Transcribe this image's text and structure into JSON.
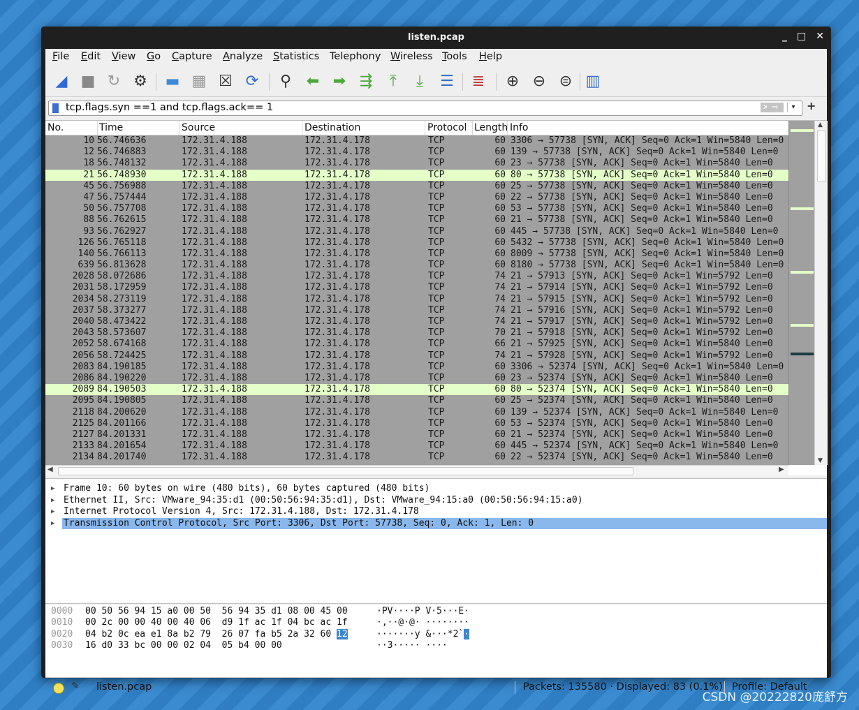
{
  "window": {
    "title": "listen.pcap",
    "controls": [
      "_",
      "□",
      "✕"
    ]
  },
  "menu": [
    {
      "label": "File",
      "key": "F",
      "rest": "ile"
    },
    {
      "label": "Edit",
      "key": "E",
      "rest": "dit"
    },
    {
      "label": "View",
      "key": "V",
      "rest": "iew"
    },
    {
      "label": "Go",
      "key": "G",
      "rest": "o"
    },
    {
      "label": "Capture",
      "key": "C",
      "rest": "apture"
    },
    {
      "label": "Analyze",
      "key": "A",
      "rest": "nalyze"
    },
    {
      "label": "Statistics",
      "key": "S",
      "rest": "tatistics"
    },
    {
      "label": "Telephony",
      "key": "",
      "rest": "Telephony"
    },
    {
      "label": "Wireless",
      "key": "W",
      "rest": "ireless"
    },
    {
      "label": "Tools",
      "key": "T",
      "rest": "ools"
    },
    {
      "label": "Help",
      "key": "H",
      "rest": "elp"
    }
  ],
  "toolbar": [
    {
      "name": "start-capture-icon",
      "glyph": "◢",
      "color": "#2d6ad3"
    },
    {
      "name": "stop-capture-icon",
      "glyph": "■",
      "color": "#8a8a8a"
    },
    {
      "name": "restart-capture-icon",
      "glyph": "↻",
      "color": "#9a9a9a"
    },
    {
      "name": "capture-options-icon",
      "glyph": "⚙",
      "color": "#333333"
    },
    {
      "name": "open-file-icon",
      "glyph": "▬",
      "color": "#3a8ad8"
    },
    {
      "name": "save-file-icon",
      "glyph": "▦",
      "color": "#9a9a9a"
    },
    {
      "name": "close-file-icon",
      "glyph": "☒",
      "color": "#333333"
    },
    {
      "name": "reload-file-icon",
      "glyph": "⟳",
      "color": "#2d6ad3"
    },
    {
      "name": "find-packet-icon",
      "glyph": "⚲",
      "color": "#333333"
    },
    {
      "name": "go-back-icon",
      "glyph": "⬅",
      "color": "#4aa83a"
    },
    {
      "name": "go-forward-icon",
      "glyph": "➡",
      "color": "#4aa83a"
    },
    {
      "name": "go-to-packet-icon",
      "glyph": "⇶",
      "color": "#4aa83a"
    },
    {
      "name": "go-first-packet-icon",
      "glyph": "⤒",
      "color": "#4aa83a"
    },
    {
      "name": "go-last-packet-icon",
      "glyph": "⤓",
      "color": "#4aa83a"
    },
    {
      "name": "auto-scroll-icon",
      "glyph": "☰",
      "color": "#3a6fc0"
    },
    {
      "name": "colorize-icon",
      "glyph": "≣",
      "color": "#c03a3a"
    },
    {
      "name": "zoom-in-icon",
      "glyph": "⊕",
      "color": "#333333"
    },
    {
      "name": "zoom-out-icon",
      "glyph": "⊖",
      "color": "#333333"
    },
    {
      "name": "normal-size-icon",
      "glyph": "⊜",
      "color": "#333333"
    },
    {
      "name": "resize-columns-icon",
      "glyph": "▥",
      "color": "#3a6fc0"
    }
  ],
  "filter": {
    "value": "tcp.flags.syn ==1 and tcp.flags.ack== 1",
    "clear_glyph": "✕",
    "apply_glyph": "⇨",
    "dropdown_glyph": "▾",
    "add_glyph": "+"
  },
  "columns": [
    "No.",
    "Time",
    "Source",
    "Destination",
    "Protocol",
    "Length",
    "Info"
  ],
  "packets": [
    {
      "no": "10",
      "time": "56.746636",
      "src": "172.31.4.188",
      "dst": "172.31.4.178",
      "proto": "TCP",
      "len": "60",
      "info": "3306 → 57738 [SYN, ACK] Seq=0 Ack=1 Win=5840 Len=0",
      "sel": false
    },
    {
      "no": "12",
      "time": "56.746883",
      "src": "172.31.4.188",
      "dst": "172.31.4.178",
      "proto": "TCP",
      "len": "60",
      "info": "139 → 57738 [SYN, ACK] Seq=0 Ack=1 Win=5840 Len=0",
      "sel": false
    },
    {
      "no": "18",
      "time": "56.748132",
      "src": "172.31.4.188",
      "dst": "172.31.4.178",
      "proto": "TCP",
      "len": "60",
      "info": "23 → 57738 [SYN, ACK] Seq=0 Ack=1 Win=5840 Len=0",
      "sel": false
    },
    {
      "no": "21",
      "time": "56.748930",
      "src": "172.31.4.188",
      "dst": "172.31.4.178",
      "proto": "TCP",
      "len": "60",
      "info": "80 → 57738 [SYN, ACK] Seq=0 Ack=1 Win=5840 Len=0",
      "sel": true
    },
    {
      "no": "45",
      "time": "56.756988",
      "src": "172.31.4.188",
      "dst": "172.31.4.178",
      "proto": "TCP",
      "len": "60",
      "info": "25 → 57738 [SYN, ACK] Seq=0 Ack=1 Win=5840 Len=0",
      "sel": false
    },
    {
      "no": "47",
      "time": "56.757444",
      "src": "172.31.4.188",
      "dst": "172.31.4.178",
      "proto": "TCP",
      "len": "60",
      "info": "22 → 57738 [SYN, ACK] Seq=0 Ack=1 Win=5840 Len=0",
      "sel": false
    },
    {
      "no": "50",
      "time": "56.757708",
      "src": "172.31.4.188",
      "dst": "172.31.4.178",
      "proto": "TCP",
      "len": "60",
      "info": "53 → 57738 [SYN, ACK] Seq=0 Ack=1 Win=5840 Len=0",
      "sel": false
    },
    {
      "no": "88",
      "time": "56.762615",
      "src": "172.31.4.188",
      "dst": "172.31.4.178",
      "proto": "TCP",
      "len": "60",
      "info": "21 → 57738 [SYN, ACK] Seq=0 Ack=1 Win=5840 Len=0",
      "sel": false
    },
    {
      "no": "93",
      "time": "56.762927",
      "src": "172.31.4.188",
      "dst": "172.31.4.178",
      "proto": "TCP",
      "len": "60",
      "info": "445 → 57738 [SYN, ACK] Seq=0 Ack=1 Win=5840 Len=0",
      "sel": false
    },
    {
      "no": "126",
      "time": "56.765118",
      "src": "172.31.4.188",
      "dst": "172.31.4.178",
      "proto": "TCP",
      "len": "60",
      "info": "5432 → 57738 [SYN, ACK] Seq=0 Ack=1 Win=5840 Len=0",
      "sel": false
    },
    {
      "no": "140",
      "time": "56.766113",
      "src": "172.31.4.188",
      "dst": "172.31.4.178",
      "proto": "TCP",
      "len": "60",
      "info": "8009 → 57738 [SYN, ACK] Seq=0 Ack=1 Win=5840 Len=0",
      "sel": false
    },
    {
      "no": "639",
      "time": "56.813628",
      "src": "172.31.4.188",
      "dst": "172.31.4.178",
      "proto": "TCP",
      "len": "60",
      "info": "8180 → 57738 [SYN, ACK] Seq=0 Ack=1 Win=5840 Len=0",
      "sel": false
    },
    {
      "no": "2028",
      "time": "58.072686",
      "src": "172.31.4.188",
      "dst": "172.31.4.178",
      "proto": "TCP",
      "len": "74",
      "info": "21 → 57913 [SYN, ACK] Seq=0 Ack=1 Win=5792 Len=0",
      "sel": false
    },
    {
      "no": "2031",
      "time": "58.172959",
      "src": "172.31.4.188",
      "dst": "172.31.4.178",
      "proto": "TCP",
      "len": "74",
      "info": "21 → 57914 [SYN, ACK] Seq=0 Ack=1 Win=5792 Len=0",
      "sel": false
    },
    {
      "no": "2034",
      "time": "58.273119",
      "src": "172.31.4.188",
      "dst": "172.31.4.178",
      "proto": "TCP",
      "len": "74",
      "info": "21 → 57915 [SYN, ACK] Seq=0 Ack=1 Win=5792 Len=0",
      "sel": false
    },
    {
      "no": "2037",
      "time": "58.373277",
      "src": "172.31.4.188",
      "dst": "172.31.4.178",
      "proto": "TCP",
      "len": "74",
      "info": "21 → 57916 [SYN, ACK] Seq=0 Ack=1 Win=5792 Len=0",
      "sel": false
    },
    {
      "no": "2040",
      "time": "58.473422",
      "src": "172.31.4.188",
      "dst": "172.31.4.178",
      "proto": "TCP",
      "len": "74",
      "info": "21 → 57917 [SYN, ACK] Seq=0 Ack=1 Win=5792 Len=0",
      "sel": false
    },
    {
      "no": "2043",
      "time": "58.573607",
      "src": "172.31.4.188",
      "dst": "172.31.4.178",
      "proto": "TCP",
      "len": "70",
      "info": "21 → 57918 [SYN, ACK] Seq=0 Ack=1 Win=5792 Len=0",
      "sel": false
    },
    {
      "no": "2052",
      "time": "58.674168",
      "src": "172.31.4.188",
      "dst": "172.31.4.178",
      "proto": "TCP",
      "len": "66",
      "info": "21 → 57925 [SYN, ACK] Seq=0 Ack=1 Win=5840 Len=0",
      "sel": false
    },
    {
      "no": "2056",
      "time": "58.724425",
      "src": "172.31.4.188",
      "dst": "172.31.4.178",
      "proto": "TCP",
      "len": "74",
      "info": "21 → 57928 [SYN, ACK] Seq=0 Ack=1 Win=5792 Len=0",
      "sel": false
    },
    {
      "no": "2083",
      "time": "84.190185",
      "src": "172.31.4.188",
      "dst": "172.31.4.178",
      "proto": "TCP",
      "len": "60",
      "info": "3306 → 52374 [SYN, ACK] Seq=0 Ack=1 Win=5840 Len=0",
      "sel": false
    },
    {
      "no": "2086",
      "time": "84.190220",
      "src": "172.31.4.188",
      "dst": "172.31.4.178",
      "proto": "TCP",
      "len": "60",
      "info": "23 → 52374 [SYN, ACK] Seq=0 Ack=1 Win=5840 Len=0",
      "sel": false
    },
    {
      "no": "2089",
      "time": "84.190503",
      "src": "172.31.4.188",
      "dst": "172.31.4.178",
      "proto": "TCP",
      "len": "60",
      "info": "80 → 52374 [SYN, ACK] Seq=0 Ack=1 Win=5840 Len=0",
      "sel": true
    },
    {
      "no": "2095",
      "time": "84.190805",
      "src": "172.31.4.188",
      "dst": "172.31.4.178",
      "proto": "TCP",
      "len": "60",
      "info": "25 → 52374 [SYN, ACK] Seq=0 Ack=1 Win=5840 Len=0",
      "sel": false
    },
    {
      "no": "2118",
      "time": "84.200620",
      "src": "172.31.4.188",
      "dst": "172.31.4.178",
      "proto": "TCP",
      "len": "60",
      "info": "139 → 52374 [SYN, ACK] Seq=0 Ack=1 Win=5840 Len=0",
      "sel": false
    },
    {
      "no": "2125",
      "time": "84.201166",
      "src": "172.31.4.188",
      "dst": "172.31.4.178",
      "proto": "TCP",
      "len": "60",
      "info": "53 → 52374 [SYN, ACK] Seq=0 Ack=1 Win=5840 Len=0",
      "sel": false
    },
    {
      "no": "2127",
      "time": "84.201331",
      "src": "172.31.4.188",
      "dst": "172.31.4.178",
      "proto": "TCP",
      "len": "60",
      "info": "21 → 52374 [SYN, ACK] Seq=0 Ack=1 Win=5840 Len=0",
      "sel": false
    },
    {
      "no": "2133",
      "time": "84.201654",
      "src": "172.31.4.188",
      "dst": "172.31.4.178",
      "proto": "TCP",
      "len": "60",
      "info": "445 → 52374 [SYN, ACK] Seq=0 Ack=1 Win=5840 Len=0",
      "sel": false
    },
    {
      "no": "2134",
      "time": "84.201740",
      "src": "172.31.4.188",
      "dst": "172.31.4.178",
      "proto": "TCP",
      "len": "60",
      "info": "22 → 52374 [SYN, ACK] Seq=0 Ack=1 Win=5840 Len=0",
      "sel": false
    }
  ],
  "minimap_marks": [
    {
      "color": "#e4ffc7"
    },
    {
      "color": "#e4ffc7"
    },
    {
      "color": "#e4ffc7"
    },
    {
      "color": "#e4ffc7"
    },
    {
      "color": "#1c3b42"
    }
  ],
  "details": [
    {
      "text": "Frame 10: 60 bytes on wire (480 bits), 60 bytes captured (480 bits)",
      "sel": false
    },
    {
      "text": "Ethernet II, Src: VMware_94:35:d1 (00:50:56:94:35:d1), Dst: VMware_94:15:a0 (00:50:56:94:15:a0)",
      "sel": false
    },
    {
      "text": "Internet Protocol Version 4, Src: 172.31.4.188, Dst: 172.31.4.178",
      "sel": false
    },
    {
      "text": "Transmission Control Protocol, Src Port: 3306, Dst Port: 57738, Seq: 0, Ack: 1, Len: 0",
      "sel": true
    }
  ],
  "bytes": [
    {
      "offset": "0000",
      "hex": "00 50 56 94 15 a0 00 50  56 94 35 d1 08 00 45 00",
      "hex_hl": "",
      "ascii": "·PV····P V·5···E·",
      "ascii_hl": ""
    },
    {
      "offset": "0010",
      "hex": "00 2c 00 00 40 00 40 06  d9 1f ac 1f 04 bc ac 1f",
      "hex_hl": "",
      "ascii": "·,··@·@· ········",
      "ascii_hl": ""
    },
    {
      "offset": "0020",
      "hex": "04 b2 0c ea e1 8a b2 79  26 07 fa b5 2a 32 60 ",
      "hex_hl": "12",
      "ascii": "·······y &···*2`",
      "ascii_hl": "·"
    },
    {
      "offset": "0030",
      "hex": "16 d0 33 bc 00 00 02 04  05 b4 00 00",
      "hex_hl": "",
      "ascii": "··3····· ····",
      "ascii_hl": ""
    }
  ],
  "status": {
    "file": "listen.pcap",
    "packets": "Packets: 135580 · Displayed: 83 (0.1%)",
    "profile": "Profile: Default"
  },
  "watermark": "CSDN @20222820庞舒方"
}
